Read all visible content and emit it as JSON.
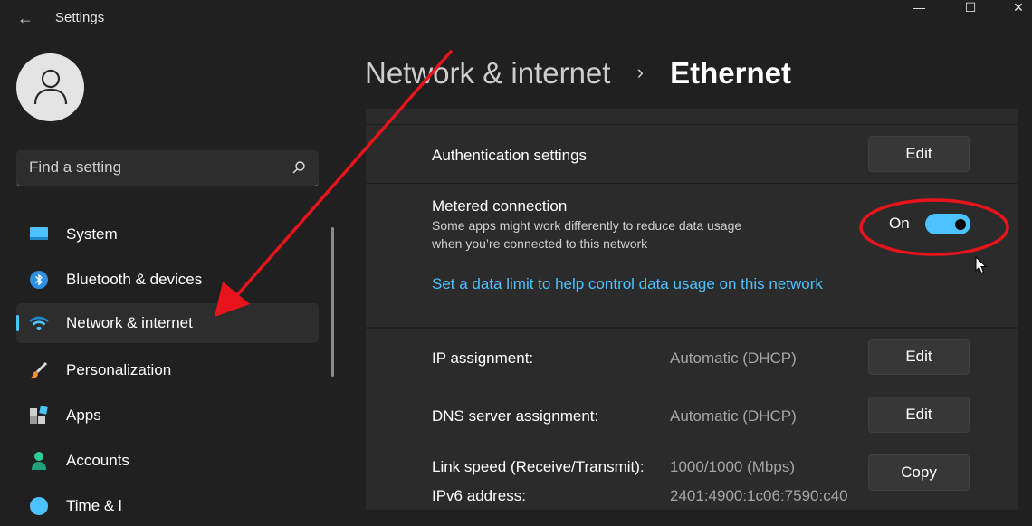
{
  "window": {
    "title": "Settings",
    "back_glyph": "←",
    "minimize_glyph": "—",
    "maximize_glyph": "☐",
    "close_glyph": "✕"
  },
  "search": {
    "placeholder": "Find a setting",
    "icon": "search-icon"
  },
  "sidebar": {
    "items": [
      {
        "label": "System",
        "icon": "system-icon",
        "selected": false
      },
      {
        "label": "Bluetooth & devices",
        "icon": "bluetooth-icon",
        "selected": false
      },
      {
        "label": "Network & internet",
        "icon": "wifi-icon",
        "selected": true
      },
      {
        "label": "Personalization",
        "icon": "brush-icon",
        "selected": false
      },
      {
        "label": "Apps",
        "icon": "apps-icon",
        "selected": false
      },
      {
        "label": "Accounts",
        "icon": "person-icon",
        "selected": false
      },
      {
        "label": "Time & l",
        "icon": "globe-icon",
        "selected": false
      }
    ]
  },
  "breadcrumb": {
    "parent": "Network & internet",
    "separator": "›",
    "current": "Ethernet"
  },
  "settings": {
    "authentication": {
      "label": "Authentication settings",
      "button": "Edit"
    },
    "metered": {
      "label": "Metered connection",
      "description_line1": "Some apps might work differently to reduce data usage",
      "description_line2": "when you’re connected to this network",
      "toggle_state": "On",
      "toggle_on": true,
      "link": "Set a data limit to help control data usage on this network"
    },
    "ip": {
      "label": "IP assignment:",
      "value": "Automatic (DHCP)",
      "button": "Edit"
    },
    "dns": {
      "label": "DNS server assignment:",
      "value": "Automatic (DHCP)",
      "button": "Edit"
    },
    "link_speed": {
      "label": "Link speed (Receive/Transmit):",
      "value": "1000/1000 (Mbps)",
      "button": "Copy"
    },
    "ipv6": {
      "label": "IPv6 address:",
      "value": "2401:4900:1c06:7590:c40"
    }
  },
  "colors": {
    "accent": "#4cc2ff",
    "annotation": "#e8141b",
    "background": "#202020",
    "card": "#2b2b2b"
  }
}
